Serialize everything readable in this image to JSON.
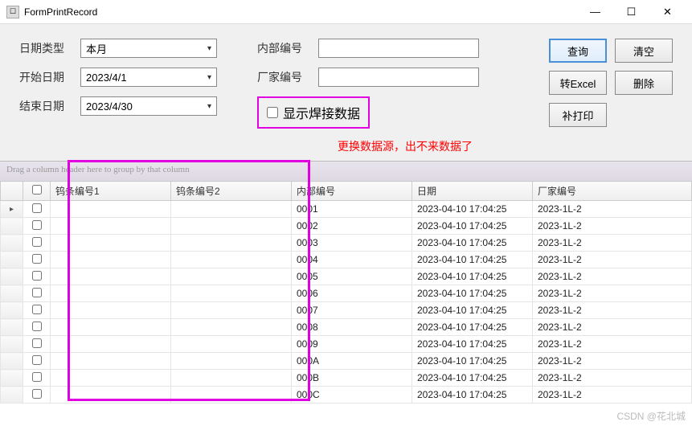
{
  "window": {
    "title": "FormPrintRecord",
    "minimize": "—",
    "maximize": "☐",
    "close": "✕"
  },
  "form": {
    "dateTypeLabel": "日期类型",
    "dateTypeValue": "本月",
    "startDateLabel": "开始日期",
    "startDateValue": "2023/4/1",
    "endDateLabel": "结束日期",
    "endDateValue": "2023/4/30",
    "innerNoLabel": "内部编号",
    "innerNoValue": "",
    "vendorNoLabel": "厂家编号",
    "vendorNoValue": "",
    "showWeldLabel": "显示焊接数据"
  },
  "buttons": {
    "query": "查询",
    "clear": "清空",
    "toExcel": "转Excel",
    "delete": "删除",
    "reprint": "补打印"
  },
  "alert": "更换数据源，出不来数据了",
  "grid": {
    "groupHint": "Drag a column header here to group by that column",
    "columns": {
      "col1": "钨条编号1",
      "col2": "钨条编号2",
      "innerNo": "内部编号",
      "date": "日期",
      "vendorNo": "厂家编号"
    },
    "rows": [
      {
        "c1": "",
        "c2": "",
        "inner": "0001",
        "date": "2023-04-10 17:04:25",
        "vendor": "2023-1L-2"
      },
      {
        "c1": "",
        "c2": "",
        "inner": "0002",
        "date": "2023-04-10 17:04:25",
        "vendor": "2023-1L-2"
      },
      {
        "c1": "",
        "c2": "",
        "inner": "0003",
        "date": "2023-04-10 17:04:25",
        "vendor": "2023-1L-2"
      },
      {
        "c1": "",
        "c2": "",
        "inner": "0004",
        "date": "2023-04-10 17:04:25",
        "vendor": "2023-1L-2"
      },
      {
        "c1": "",
        "c2": "",
        "inner": "0005",
        "date": "2023-04-10 17:04:25",
        "vendor": "2023-1L-2"
      },
      {
        "c1": "",
        "c2": "",
        "inner": "0006",
        "date": "2023-04-10 17:04:25",
        "vendor": "2023-1L-2"
      },
      {
        "c1": "",
        "c2": "",
        "inner": "0007",
        "date": "2023-04-10 17:04:25",
        "vendor": "2023-1L-2"
      },
      {
        "c1": "",
        "c2": "",
        "inner": "0008",
        "date": "2023-04-10 17:04:25",
        "vendor": "2023-1L-2"
      },
      {
        "c1": "",
        "c2": "",
        "inner": "0009",
        "date": "2023-04-10 17:04:25",
        "vendor": "2023-1L-2"
      },
      {
        "c1": "",
        "c2": "",
        "inner": "000A",
        "date": "2023-04-10 17:04:25",
        "vendor": "2023-1L-2"
      },
      {
        "c1": "",
        "c2": "",
        "inner": "000B",
        "date": "2023-04-10 17:04:25",
        "vendor": "2023-1L-2"
      },
      {
        "c1": "",
        "c2": "",
        "inner": "000C",
        "date": "2023-04-10 17:04:25",
        "vendor": "2023-1L-2"
      }
    ],
    "lastPartialVendor": "2023-1L-2"
  },
  "watermark": "CSDN @花北城"
}
